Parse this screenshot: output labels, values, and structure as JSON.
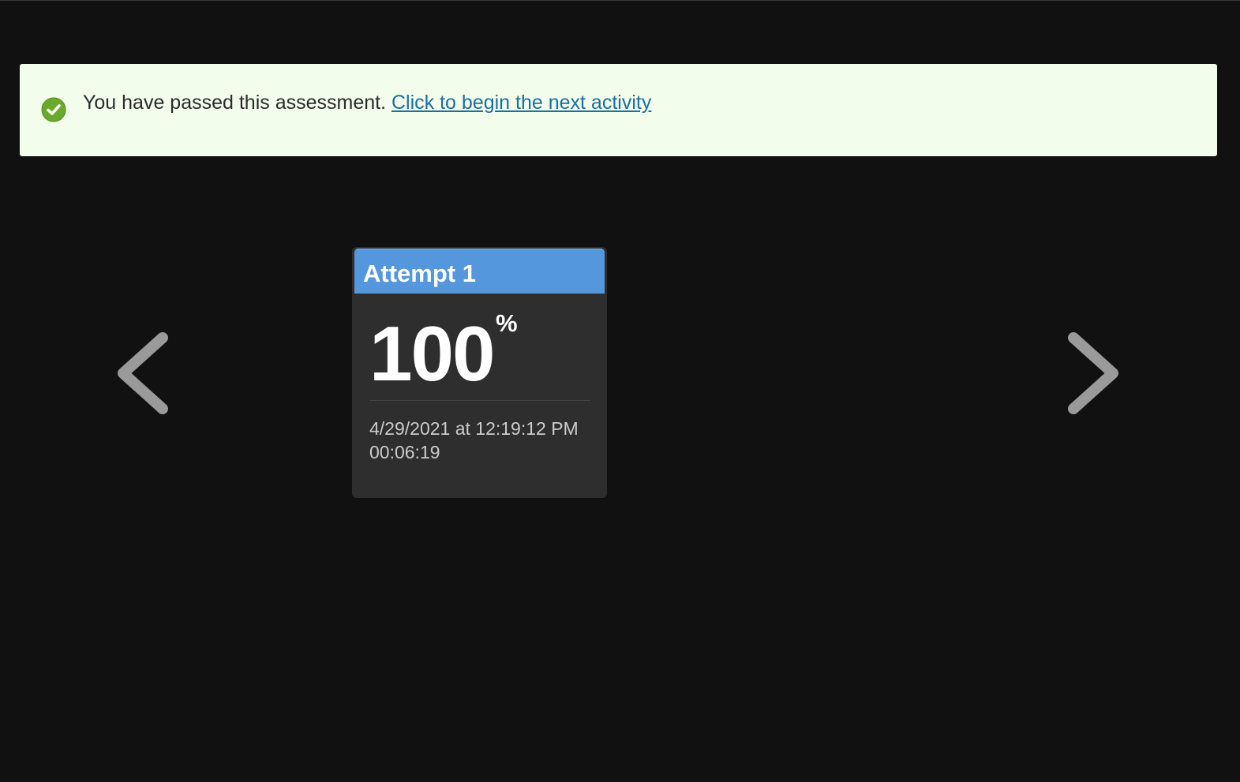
{
  "banner": {
    "message": "You have passed this assessment.",
    "link_label": "Click to begin the next activity",
    "icon": "check-circle-icon",
    "background_color": "#f2fdec",
    "icon_color": "#6aa92a",
    "link_color": "#1a6fa3"
  },
  "navigation": {
    "prev_icon": "chevron-left-icon",
    "next_icon": "chevron-right-icon",
    "arrow_color": "#9a9a9a"
  },
  "attempts": [
    {
      "title": "Attempt 1",
      "score": "100",
      "score_unit": "%",
      "date": "4/29/2021 at 12:19:12 PM",
      "duration": "00:06:19",
      "header_color": "#5597dc"
    }
  ]
}
